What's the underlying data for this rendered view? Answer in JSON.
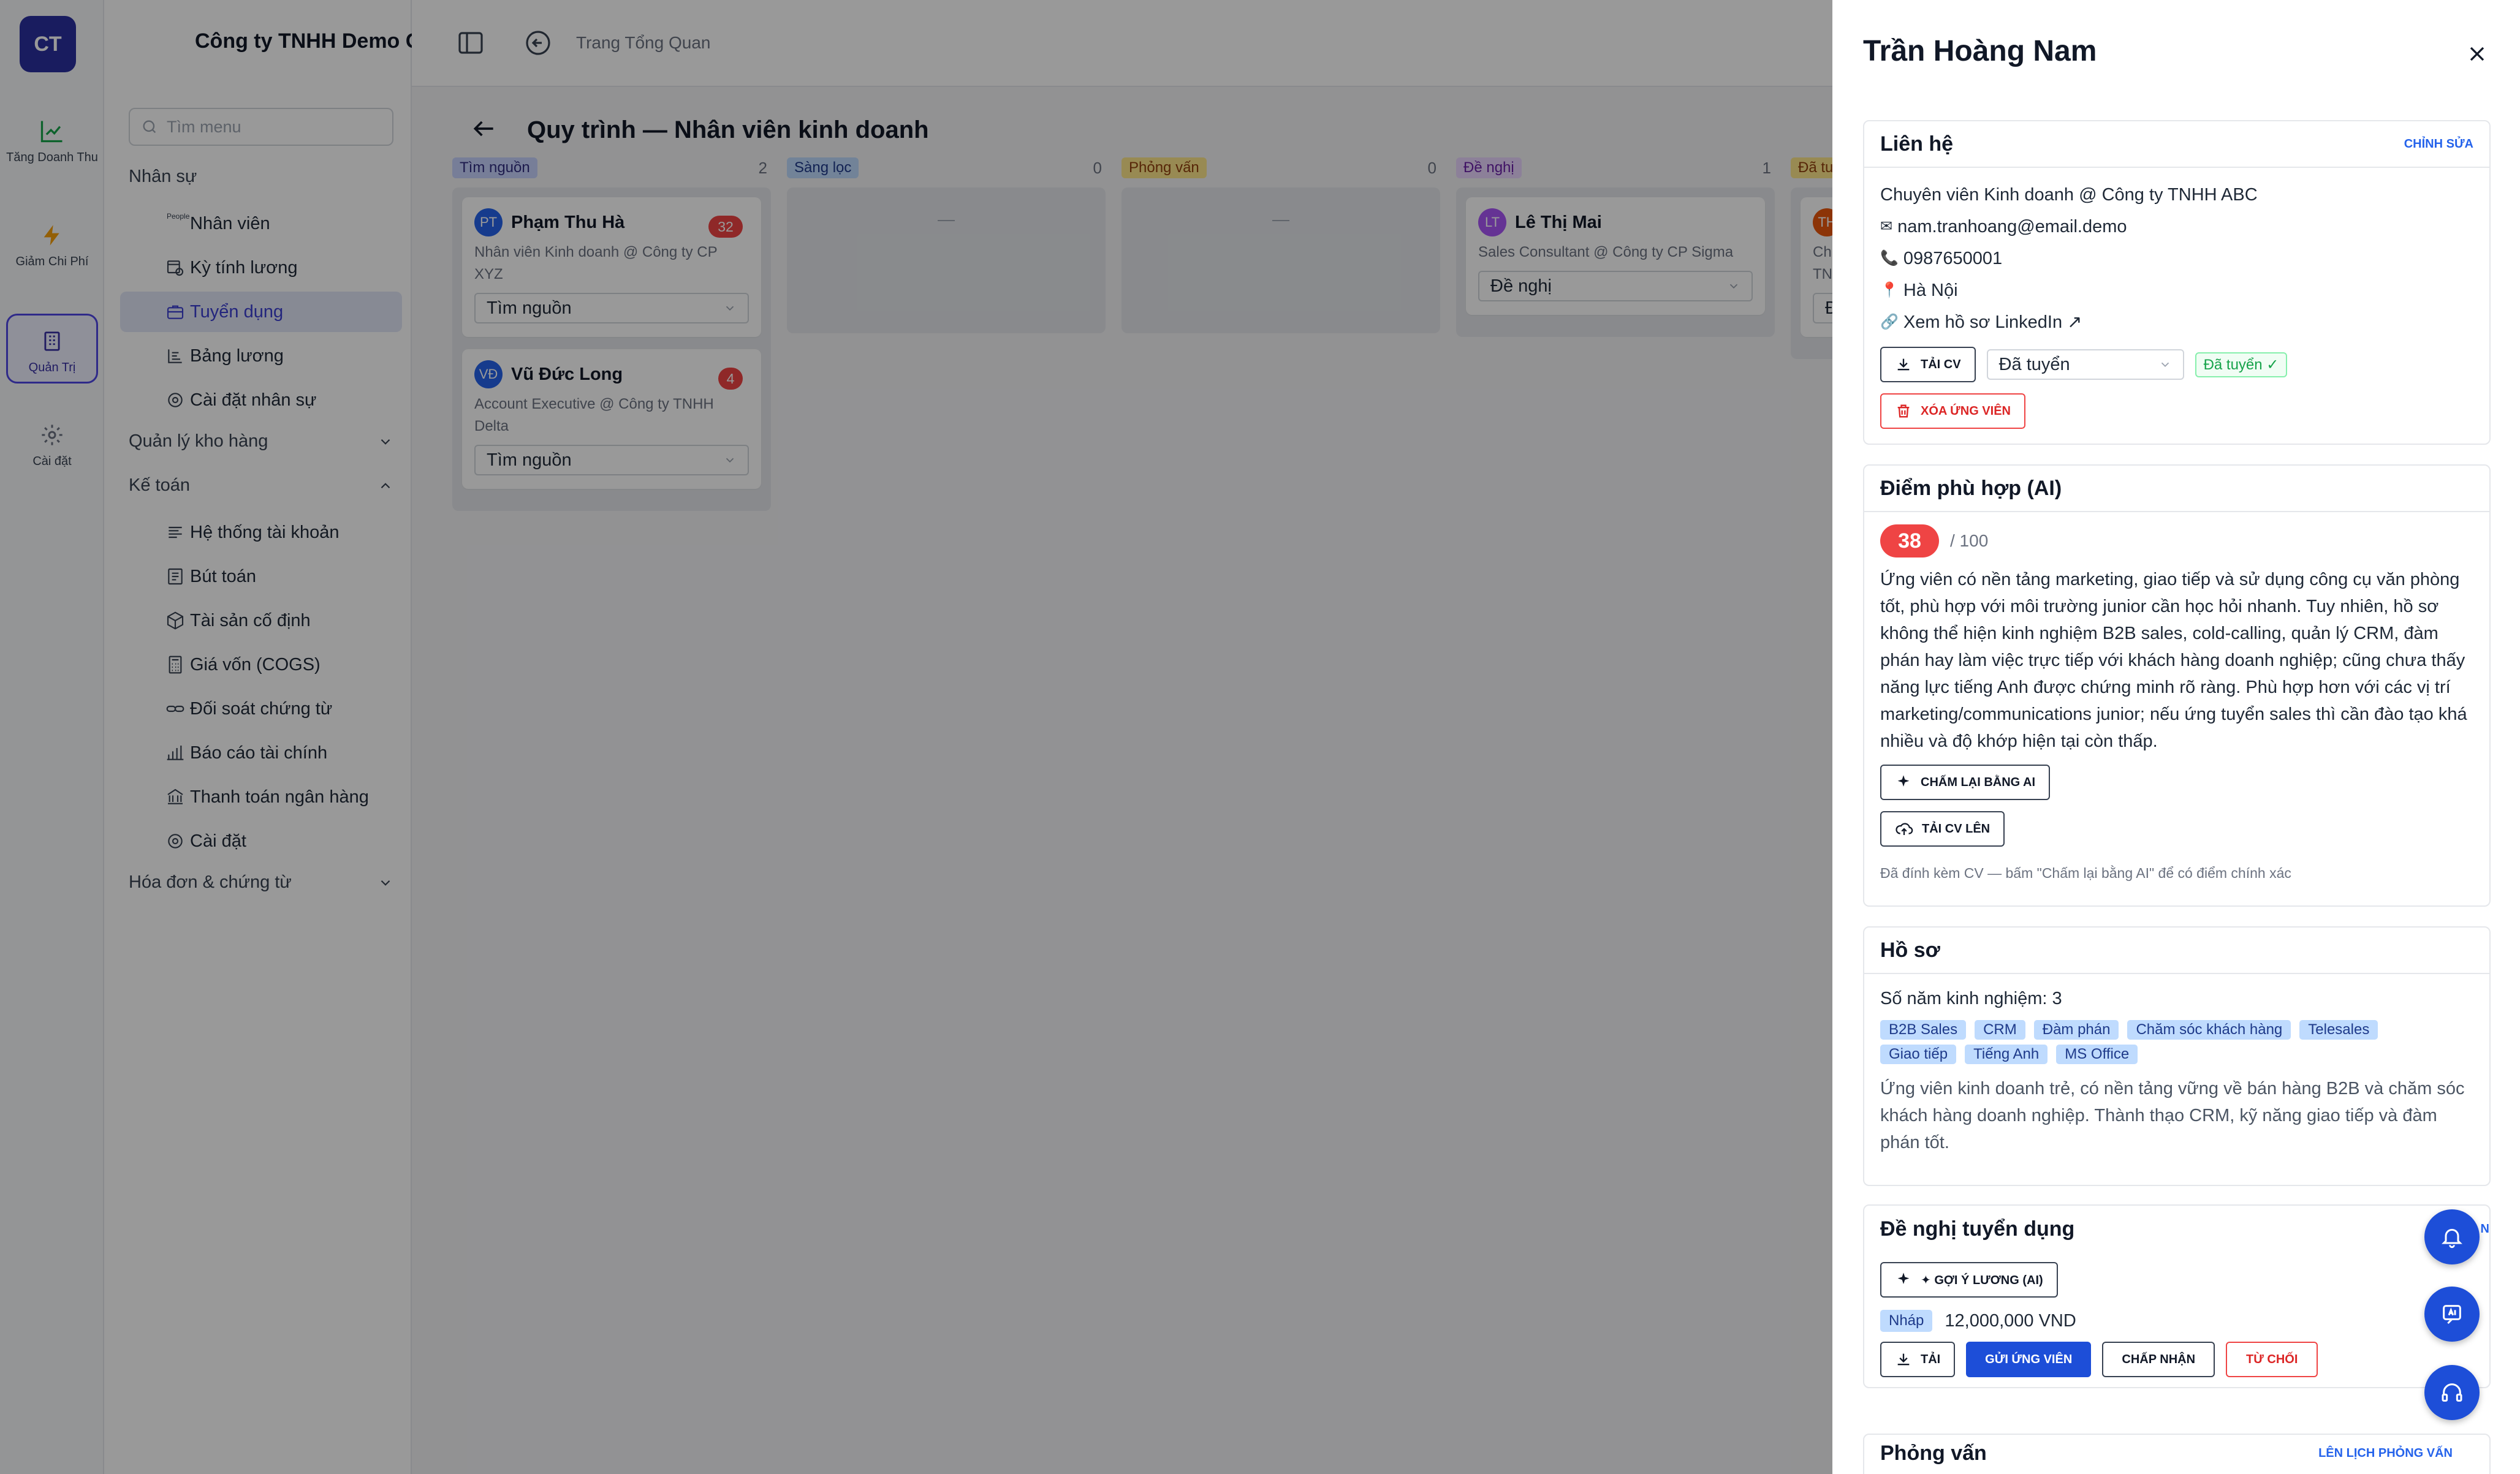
{
  "rail": {
    "logo": "CT",
    "items": [
      {
        "label": "Tăng Doanh Thu"
      },
      {
        "label": "Giảm Chi Phí"
      },
      {
        "label": "Quản Trị"
      },
      {
        "label": "Cài đặt"
      }
    ]
  },
  "sidebar": {
    "company": "Công ty TNHH Demo GTG",
    "search_placeholder": "Tìm menu",
    "groups": {
      "hr": "Nhân sự",
      "warehouse": "Quản lý kho hàng",
      "accounting": "Kế toán",
      "invoices": "Hóa đơn & chứng từ"
    },
    "hr_items": [
      "Nhân viên",
      "Kỳ tính lương",
      "Tuyển dụng",
      "Bảng lương",
      "Cài đặt nhân sự"
    ],
    "people_tiny": "People",
    "acc_items": [
      "Hệ thống tài khoản",
      "Bút toán",
      "Tài sản cố định",
      "Giá vốn (COGS)",
      "Đối soát chứng từ",
      "Báo cáo tài chính",
      "Thanh toán ngân hàng",
      "Cài đặt"
    ]
  },
  "main": {
    "breadcrumb": "Trang Tổng Quan",
    "title": "Quy trình — Nhân viên kinh doanh",
    "columns": [
      {
        "stage": "Tìm nguồn",
        "count": "2"
      },
      {
        "stage": "Sàng lọc",
        "count": "0",
        "empty": "—"
      },
      {
        "stage": "Phỏng vấn",
        "count": "0",
        "empty": "—"
      },
      {
        "stage": "Đề nghị",
        "count": "1"
      },
      {
        "stage": "Đã tu"
      }
    ],
    "cards": [
      {
        "initials": "PT",
        "name": "Phạm Thu Hà",
        "score": "32",
        "sub": "Nhân viên Kinh doanh @ Công ty CP XYZ",
        "stage": "Tìm nguồn"
      },
      {
        "initials": "VĐ",
        "name": "Vũ Đức Long",
        "score": "4",
        "sub": "Account Executive @ Công ty TNHH Delta",
        "stage": "Tìm nguồn"
      },
      {
        "initials": "LT",
        "name": "Lê Thị Mai",
        "sub": "Sales Consultant @ Công ty CP Sigma",
        "stage": "Đề nghị"
      },
      {
        "initials": "TH",
        "sub1": "Chu",
        "sub2": "TNH",
        "stage": "Đ"
      }
    ]
  },
  "panel": {
    "name": "Trần Hoàng Nam",
    "contact": {
      "title": "Liên hệ",
      "edit": "CHỈNH SỬA",
      "headline": "Chuyên viên Kinh doanh @ Công ty TNHH ABC",
      "email": "nam.tranhoang@email.demo",
      "phone": "0987650001",
      "location": "Hà Nội",
      "linkedin": "Xem hồ sơ LinkedIn ↗",
      "download_cv": "TẢI CV",
      "status": "Đã tuyển",
      "status_badge": "Đã tuyển ✓",
      "delete": "XÓA ỨNG VIÊN"
    },
    "ai": {
      "title": "Điểm phù hợp (AI)",
      "score": "38",
      "max": "/ 100",
      "summary": "Ứng viên có nền tảng marketing, giao tiếp và sử dụng công cụ văn phòng tốt, phù hợp với môi trường junior cần học hỏi nhanh. Tuy nhiên, hồ sơ không thể hiện kinh nghiệm B2B sales, cold-calling, quản lý CRM, đàm phán hay làm việc trực tiếp với khách hàng doanh nghiệp; cũng chưa thấy năng lực tiếng Anh được chứng minh rõ ràng. Phù hợp hơn với các vị trí marketing/communications junior; nếu ứng tuyển sales thì cần đào tạo khá nhiều và độ khớp hiện tại còn thấp.",
      "rescore": "CHẤM LẠI BẰNG AI",
      "upload": "TẢI CV LÊN",
      "note": "Đã đính kèm CV — bấm \"Chấm lại bằng AI\" để có điểm chính xác"
    },
    "profile": {
      "title": "Hồ sơ",
      "years": "Số năm kinh nghiệm: 3",
      "tags": [
        "B2B Sales",
        "CRM",
        "Đàm phán",
        "Chăm sóc khách hàng",
        "Telesales",
        "Giao tiếp",
        "Tiếng Anh",
        "MS Office"
      ],
      "summary": "Ứng viên kinh doanh trẻ, có nền tảng vững về bán hàng B2B và chăm sóc khách hàng doanh nghiệp. Thành thạo CRM, kỹ năng giao tiếp và đàm phán tốt."
    },
    "offer": {
      "title": "Đề nghị tuyển dụng",
      "create": "TẠO ĐỀ N",
      "suggest": "✦ GỢI Ý LƯƠNG (AI)",
      "draft": "Nháp",
      "amount": "12,000,000 VND",
      "download": "TẢI",
      "send": "GỬI ỨNG VIÊN",
      "accept": "CHẤP NHẬN",
      "reject": "TỪ CHỐI"
    },
    "interview": {
      "title": "Phỏng vấn",
      "schedule": "LÊN LỊCH PHỎNG VẤN"
    }
  },
  "colors": {
    "primary": "#1d4ed8",
    "brand": "#2a2f9e",
    "danger": "#ef4444",
    "success": "#16a34a"
  }
}
